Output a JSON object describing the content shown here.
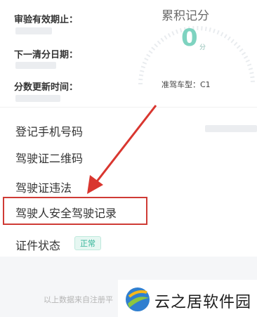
{
  "info": {
    "inspection_label": "审验有效期止：",
    "next_clear_label": "下一清分日期：",
    "score_update_label": "分数更新时间："
  },
  "score": {
    "title": "累积记分",
    "value": "0",
    "unit": "分",
    "car_type": "准驾车型：C1"
  },
  "menu": {
    "phone": "登记手机号码",
    "qr": "驾驶证二维码",
    "violation": "驾驶证违法",
    "safe_record": "驾驶人安全驾驶记录",
    "status": "证件状态",
    "status_badge": "正常"
  },
  "footer": {
    "text": "以上数据来自注册平"
  },
  "watermark": {
    "text": "云之居软件园"
  },
  "colors": {
    "accent_green": "#7ed3c0",
    "highlight_red": "#cf3b35"
  }
}
